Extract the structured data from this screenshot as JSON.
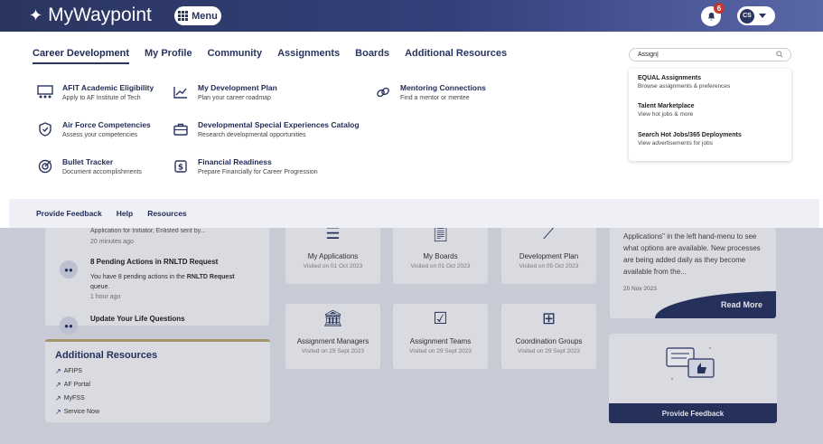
{
  "header": {
    "app_name": "MyWaypoint",
    "menu_label": "Menu",
    "notification_count": "6",
    "user_initials": "CS"
  },
  "mega_menu": {
    "tabs": [
      {
        "label": "Career Development"
      },
      {
        "label": "My Profile"
      },
      {
        "label": "Community"
      },
      {
        "label": "Assignments"
      },
      {
        "label": "Boards"
      },
      {
        "label": "Additional Resources"
      }
    ],
    "items": [
      {
        "title": "AFIT Academic Eligibility",
        "subtitle": "Apply to AF Institute of Tech",
        "icon": "classroom-icon"
      },
      {
        "title": "Air Force Competencies",
        "subtitle": "Assess your competencies",
        "icon": "shield-check-icon"
      },
      {
        "title": "Bullet Tracker",
        "subtitle": "Document accomplishments",
        "icon": "target-icon"
      },
      {
        "title": "My Development Plan",
        "subtitle": "Plan your career roadmap",
        "icon": "trend-chart-icon"
      },
      {
        "title": "Developmental Special Experiences Catalog",
        "subtitle": "Research developmental opportunities",
        "icon": "briefcase-icon"
      },
      {
        "title": "Financial Readiness",
        "subtitle": "Prepare Financially for Career Progression",
        "icon": "dollar-icon"
      },
      {
        "title": "Mentoring Connections",
        "subtitle": "Find a mentor or mentee",
        "icon": "link-icon"
      }
    ],
    "footer_links": [
      {
        "label": "Provide Feedback"
      },
      {
        "label": "Help"
      },
      {
        "label": "Resources"
      }
    ],
    "search": {
      "value": "Assign|",
      "results": [
        {
          "title": "EQUAL Assignments",
          "subtitle": "Browse assignments & preferences"
        },
        {
          "title": "Talent Marketplace",
          "subtitle": "View hot jobs & more"
        },
        {
          "title": "Search Hot Jobs/365 Deployments",
          "subtitle": "View advertisements for jobs"
        }
      ]
    }
  },
  "activity": {
    "partial_line": "Application for Initiator, Enlisted sent by...",
    "partial_time": "20 minutes ago",
    "item_title": "8 Pending Actions in RNLTD Request",
    "item_body_pre": "You have 8 pending actions in the ",
    "item_body_bold": "RNLTD Request",
    "item_body_post": "queue.",
    "item_time": "1 hour ago",
    "next_title": "Update Your Life Questions"
  },
  "additional_resources": {
    "title": "Additional Resources",
    "links": [
      {
        "label": "AFIPS"
      },
      {
        "label": "AF Portal"
      },
      {
        "label": "MyFSS"
      },
      {
        "label": "Service Now"
      }
    ]
  },
  "tiles": [
    {
      "name": "My Applications",
      "visited": "Visited on 01 Oct 2023",
      "icon": "list-icon"
    },
    {
      "name": "My Boards",
      "visited": "Visited on 01 Oct 2023",
      "icon": "clipboard-icon"
    },
    {
      "name": "Development Plan",
      "visited": "Visited on 05 Oct 2023",
      "icon": "trend-chart-icon"
    },
    {
      "name": "Assignment Managers",
      "visited": "Visited on 29 Sept 2023",
      "icon": "building-icon"
    },
    {
      "name": "Assignment Teams",
      "visited": "Visited on 29 Sept 2023",
      "icon": "checklist-icon"
    },
    {
      "name": "Coordination Groups",
      "visited": "Visited on 29 Sept 2023",
      "icon": "org-chart-icon"
    }
  ],
  "news": {
    "text": "Applications\" in the left hand-menu to see what options are available. New processes are being added daily as they become available from the...",
    "date": "20 Nov 2023",
    "read_more": "Read More"
  },
  "feedback_card": {
    "button": "Provide Feedback"
  },
  "colors": {
    "brand": "#2a3560",
    "accent_gold": "#b8a774",
    "notification": "#c23a2b"
  }
}
